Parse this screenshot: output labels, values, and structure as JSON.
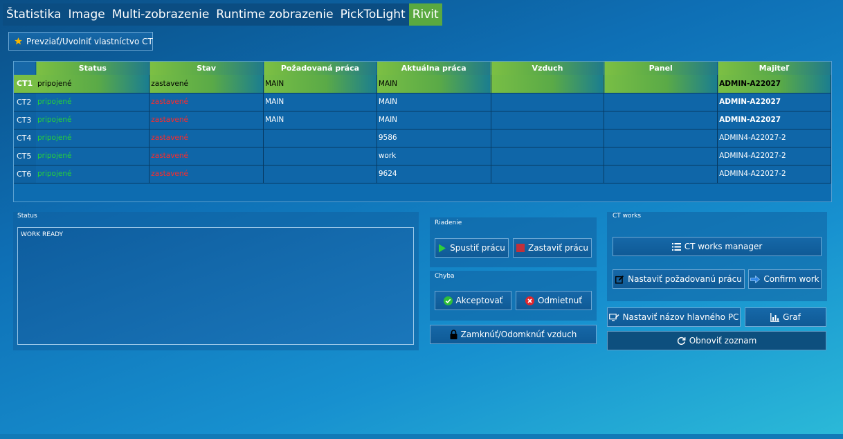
{
  "tabs": [
    {
      "label": "Štatistika",
      "active": false
    },
    {
      "label": "Image",
      "active": false
    },
    {
      "label": "Multi-zobrazenie",
      "active": false
    },
    {
      "label": "Runtime zobrazenie",
      "active": false
    },
    {
      "label": "PickToLight",
      "active": false
    },
    {
      "label": "Rivit",
      "active": true
    }
  ],
  "ownership_button": {
    "label": "Prevziať/Uvolniť vlastníctvo CT",
    "icon": "star-icon"
  },
  "grid": {
    "columns": [
      "Status",
      "Stav",
      "Požadovaná práca",
      "Aktuálna práca",
      "Vzduch",
      "Panel",
      "Majiteľ"
    ],
    "rows": [
      {
        "name": "CT1",
        "status": "pripojené",
        "stav": "zastavené",
        "pozadovana": "MAIN",
        "aktualna": "MAIN",
        "vzduch": "",
        "panel": "",
        "majitel": "ADMIN-A22027"
      },
      {
        "name": "CT2",
        "status": "pripojené",
        "stav": "zastavené",
        "pozadovana": "MAIN",
        "aktualna": "MAIN",
        "vzduch": "",
        "panel": "",
        "majitel": "ADMIN-A22027"
      },
      {
        "name": "CT3",
        "status": "pripojené",
        "stav": "zastavené",
        "pozadovana": "MAIN",
        "aktualna": "MAIN",
        "vzduch": "",
        "panel": "",
        "majitel": "ADMIN-A22027"
      },
      {
        "name": "CT4",
        "status": "pripojené",
        "stav": "zastavené",
        "pozadovana": "",
        "aktualna": "9586",
        "vzduch": "",
        "panel": "",
        "majitel": "ADMIN4-A22027-2"
      },
      {
        "name": "CT5",
        "status": "pripojené",
        "stav": "zastavené",
        "pozadovana": "",
        "aktualna": "work",
        "vzduch": "",
        "panel": "",
        "majitel": "ADMIN4-A22027-2"
      },
      {
        "name": "CT6",
        "status": "pripojené",
        "stav": "zastavené",
        "pozadovana": "",
        "aktualna": "9624",
        "vzduch": "",
        "panel": "",
        "majitel": "ADMIN4-A22027-2"
      }
    ]
  },
  "status_panel": {
    "label": "Status",
    "text": "WORK READY"
  },
  "riadenie": {
    "label": "Riadenie",
    "start_label": "Spustiť prácu",
    "stop_label": "Zastaviť prácu"
  },
  "chyba": {
    "label": "Chyba",
    "accept_label": "Akceptovať",
    "reject_label": "Odmietnuť"
  },
  "lock_air_label": "Zamknúť/Odomknúť vzduch",
  "ct_works": {
    "label": "CT works",
    "manager_label": "CT works manager",
    "set_work_label": "Nastaviť požadovanú prácu",
    "confirm_label": "Confirm work"
  },
  "set_pc_name_label": "Nastaviť názov hlavného PC",
  "graph_label": "Graf",
  "refresh_label": "Obnoviť zoznam",
  "colors": {
    "accent_green": "#5aa940",
    "ok_green": "#26d13a",
    "error_red": "#ff2a2a",
    "tab_bg": "#0b4d82"
  }
}
